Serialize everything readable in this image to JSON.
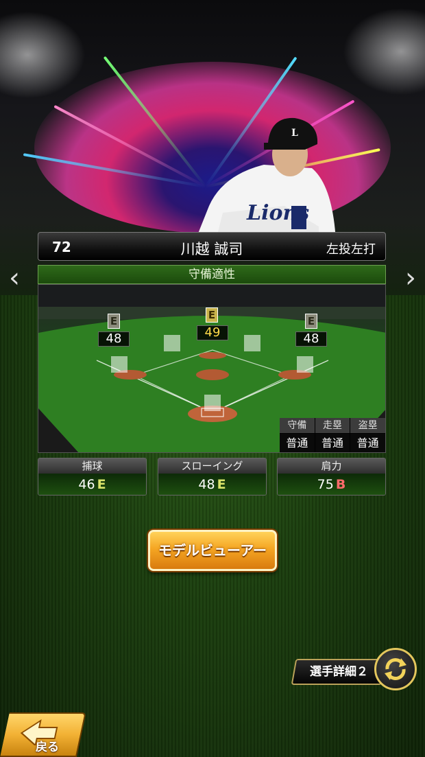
{
  "player": {
    "number": "72",
    "name": "川越 誠司",
    "handedness": "左投左打"
  },
  "defense_panel": {
    "title": "守備適性",
    "positions": [
      {
        "id": "left-field",
        "grade": "E",
        "value": "48",
        "highlight": false
      },
      {
        "id": "center-field",
        "grade": "E",
        "value": "49",
        "highlight": true
      },
      {
        "id": "right-field",
        "grade": "E",
        "value": "48",
        "highlight": false
      }
    ],
    "mini_table": {
      "headers": [
        "守備",
        "走塁",
        "盗塁"
      ],
      "values": [
        "普通",
        "普通",
        "普通"
      ]
    }
  },
  "stats": [
    {
      "label": "捕球",
      "value": "46",
      "grade": "E",
      "grade_color": "#d9e36a"
    },
    {
      "label": "スローイング",
      "value": "48",
      "grade": "E",
      "grade_color": "#d9e36a"
    },
    {
      "label": "肩力",
      "value": "75",
      "grade": "B",
      "grade_color": "#ff6b6b"
    }
  ],
  "buttons": {
    "model_viewer": "モデルビューアー",
    "details": "選手詳細２",
    "back": "戻る"
  },
  "icons": {
    "prev": "chevron-left-icon",
    "next": "chevron-right-icon",
    "cycle": "cycle-arrows-icon",
    "back": "back-arrow-icon"
  }
}
